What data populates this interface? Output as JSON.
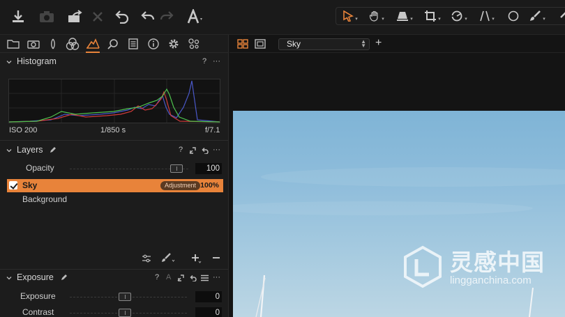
{
  "toolbar": {
    "left_icons": [
      "import-icon",
      "camera-icon",
      "export-icon",
      "delete-icon",
      "reset-icon",
      "undo-icon",
      "redo-icon",
      "text-icon"
    ],
    "tools": [
      "select-cursor-icon",
      "pan-hand-icon",
      "keystone-icon",
      "crop-icon",
      "rotate-icon",
      "straighten-icon",
      "circle-mask-icon",
      "brush-icon"
    ],
    "accent": "#e8833a"
  },
  "tool_tabs": [
    "library-icon",
    "capture-icon",
    "lens-icon",
    "color-icon",
    "exposure-icon",
    "details-icon",
    "metadata-icon",
    "info-icon",
    "settings-icon",
    "batch-icon"
  ],
  "histogram": {
    "title": "Histogram",
    "iso": "ISO 200",
    "shutter": "1/850 s",
    "aperture": "f/7.1",
    "help": "?",
    "more": "···"
  },
  "layers": {
    "title": "Layers",
    "help": "?",
    "more": "···",
    "opacity_label": "Opacity",
    "opacity_value": "100",
    "opacity_level": 1.0,
    "items": [
      {
        "name": "Sky",
        "badge": "Adjustment",
        "opacity": "100%",
        "checked": true,
        "selected": true
      },
      {
        "name": "Background"
      }
    ]
  },
  "exposure": {
    "title": "Exposure",
    "help": "?",
    "auto": "A",
    "more": "···",
    "rows": [
      {
        "label": "Exposure",
        "value": "0"
      },
      {
        "label": "Contrast",
        "value": "0"
      }
    ]
  },
  "viewer": {
    "variant_name": "Sky",
    "add": "+"
  },
  "watermark": {
    "text_cn": "灵感中国",
    "text_url": "lingganchina.com"
  }
}
